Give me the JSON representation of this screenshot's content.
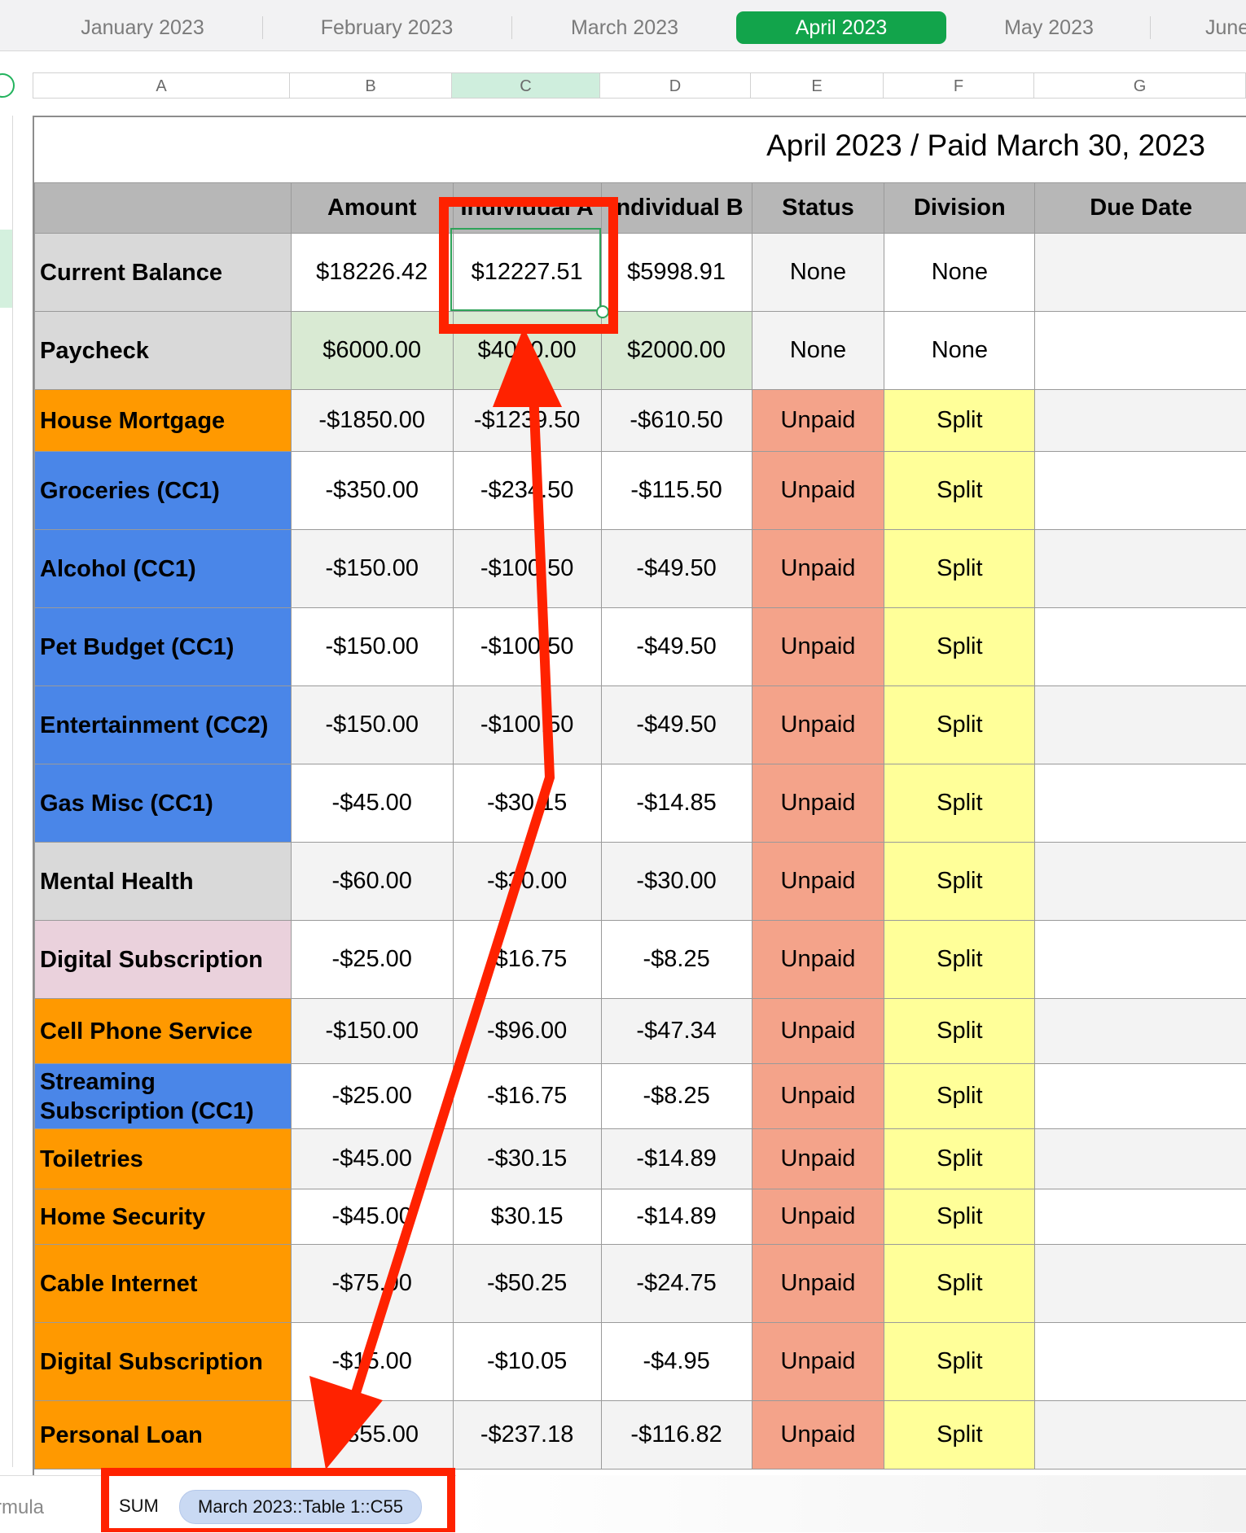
{
  "sheet_tabs": [
    {
      "label": "January 2023",
      "active": false
    },
    {
      "label": "February 2023",
      "active": false
    },
    {
      "label": "March 2023",
      "active": false
    },
    {
      "label": "April 2023",
      "active": true
    },
    {
      "label": "May 2023",
      "active": false
    },
    {
      "label": "June",
      "active": false
    }
  ],
  "columns": [
    "A",
    "B",
    "C",
    "D",
    "E",
    "F",
    "G"
  ],
  "selected_column": "C",
  "table": {
    "title": "April 2023 / Paid March 30, 2023",
    "headers": [
      "",
      "Amount",
      "Individual A",
      "Individual B",
      "Status",
      "Division",
      "Due Date"
    ],
    "rows": [
      {
        "label": "Current Balance",
        "amount": "$18226.42",
        "a": "$12227.51",
        "b": "$5998.91",
        "status": "None",
        "division": "None",
        "due": ""
      },
      {
        "label": "Paycheck",
        "amount": "$6000.00",
        "a": "$4000.00",
        "b": "$2000.00",
        "status": "None",
        "division": "None",
        "due": ""
      },
      {
        "label": "House Mortgage",
        "amount": "-$1850.00",
        "a": "-$1239.50",
        "b": "-$610.50",
        "status": "Unpaid",
        "division": "Split",
        "due": ""
      },
      {
        "label": "Groceries (CC1)",
        "amount": "-$350.00",
        "a": "-$234.50",
        "b": "-$115.50",
        "status": "Unpaid",
        "division": "Split",
        "due": ""
      },
      {
        "label": "Alcohol (CC1)",
        "amount": "-$150.00",
        "a": "-$100.50",
        "b": "-$49.50",
        "status": "Unpaid",
        "division": "Split",
        "due": ""
      },
      {
        "label": "Pet Budget (CC1)",
        "amount": "-$150.00",
        "a": "-$100.50",
        "b": "-$49.50",
        "status": "Unpaid",
        "division": "Split",
        "due": ""
      },
      {
        "label": "Entertainment (CC2)",
        "amount": "-$150.00",
        "a": "-$100.50",
        "b": "-$49.50",
        "status": "Unpaid",
        "division": "Split",
        "due": ""
      },
      {
        "label": "Gas Misc (CC1)",
        "amount": "-$45.00",
        "a": "-$30.15",
        "b": "-$14.85",
        "status": "Unpaid",
        "division": "Split",
        "due": ""
      },
      {
        "label": "Mental Health",
        "amount": "-$60.00",
        "a": "-$30.00",
        "b": "-$30.00",
        "status": "Unpaid",
        "division": "Split",
        "due": ""
      },
      {
        "label": "Digital Subscription",
        "amount": "-$25.00",
        "a": "-$16.75",
        "b": "-$8.25",
        "status": "Unpaid",
        "division": "Split",
        "due": ""
      },
      {
        "label": "Cell Phone Service",
        "amount": "-$150.00",
        "a": "-$96.00",
        "b": "-$47.34",
        "status": "Unpaid",
        "division": "Split",
        "due": ""
      },
      {
        "label": "Streaming Subscription (CC1)",
        "amount": "-$25.00",
        "a": "-$16.75",
        "b": "-$8.25",
        "status": "Unpaid",
        "division": "Split",
        "due": ""
      },
      {
        "label": "Toiletries",
        "amount": "-$45.00",
        "a": "-$30.15",
        "b": "-$14.89",
        "status": "Unpaid",
        "division": "Split",
        "due": ""
      },
      {
        "label": "Home Security",
        "amount": "-$45.00",
        "a": "$30.15",
        "b": "-$14.89",
        "status": "Unpaid",
        "division": "Split",
        "due": ""
      },
      {
        "label": "Cable Internet",
        "amount": "-$75.00",
        "a": "-$50.25",
        "b": "-$24.75",
        "status": "Unpaid",
        "division": "Split",
        "due": ""
      },
      {
        "label": "Digital Subscription",
        "amount": "-$15.00",
        "a": "-$10.05",
        "b": "-$4.95",
        "status": "Unpaid",
        "division": "Split",
        "due": ""
      },
      {
        "label": "Personal Loan",
        "amount": "-$355.00",
        "a": "-$237.18",
        "b": "-$116.82",
        "status": "Unpaid",
        "division": "Split",
        "due": ""
      }
    ]
  },
  "formula_bar": {
    "label": "rmula",
    "function": "SUM",
    "reference": "March 2023::Table 1::C55"
  },
  "colors": {
    "active_tab": "#12a44b",
    "label_gray": "#d9d9d9",
    "label_orange": "#ff9900",
    "label_blue": "#4a86e8",
    "label_pink": "#ead1dc",
    "status_unpaid": "#f4a38a",
    "division_split": "#ffff99",
    "annotation_red": "#ff2200"
  }
}
